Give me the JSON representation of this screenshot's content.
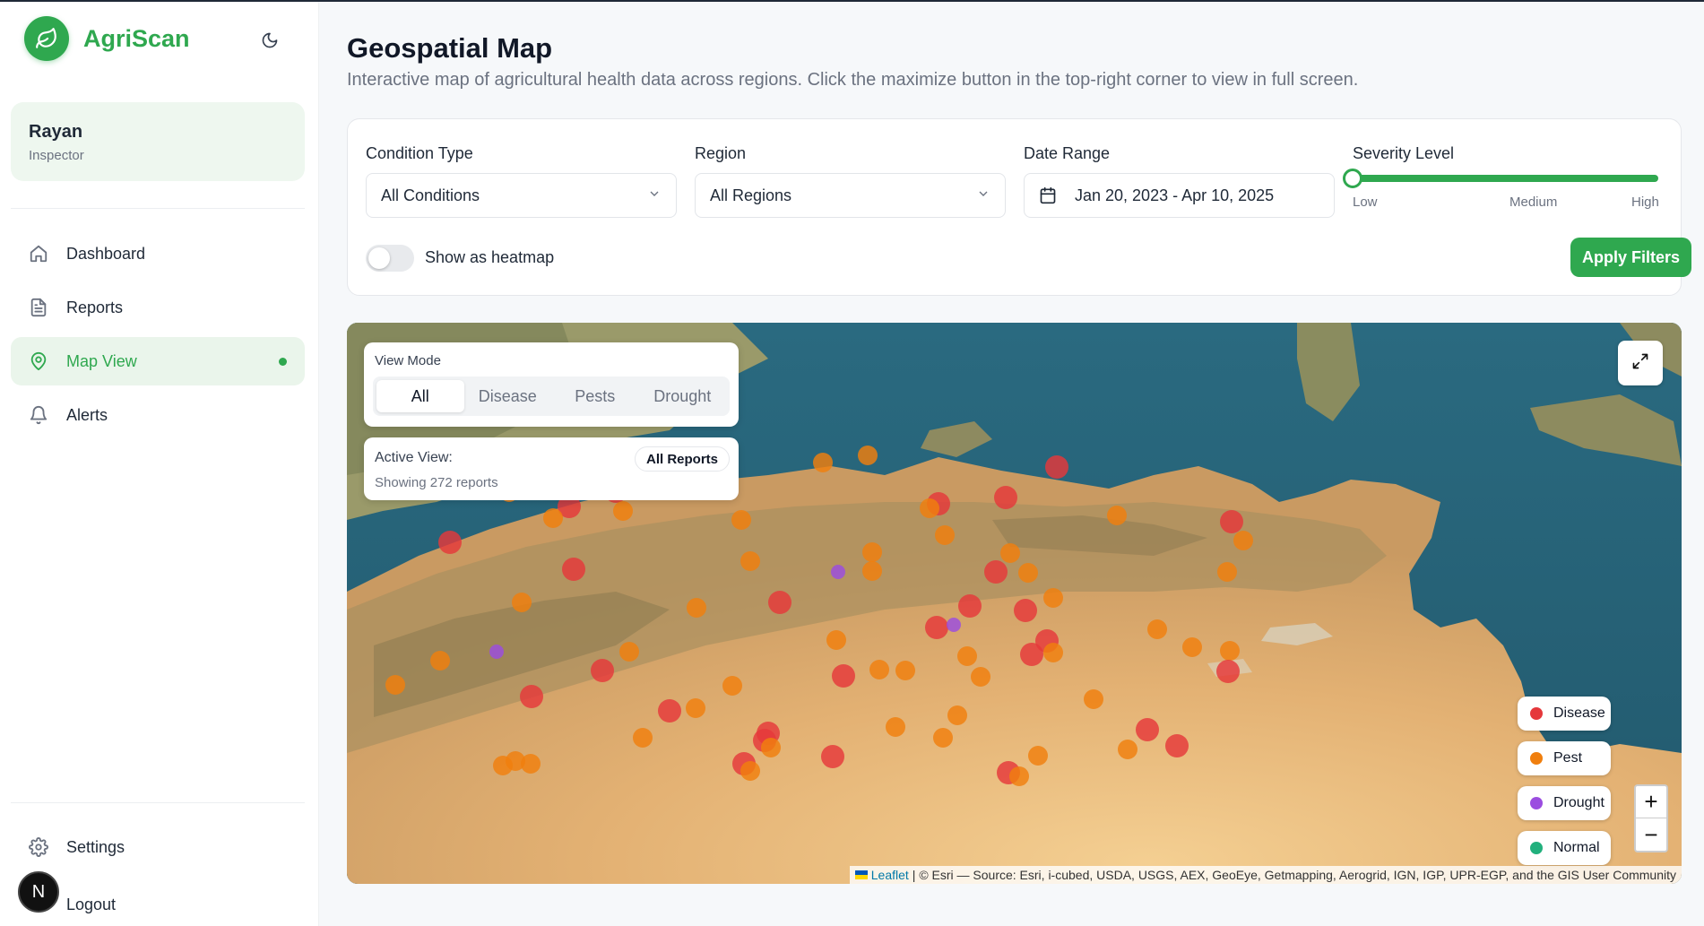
{
  "brand": {
    "name": "AgriScan"
  },
  "user": {
    "name": "Rayan",
    "role": "Inspector"
  },
  "nav": {
    "items": [
      {
        "label": "Dashboard"
      },
      {
        "label": "Reports"
      },
      {
        "label": "Map View"
      },
      {
        "label": "Alerts"
      }
    ],
    "settings": "Settings",
    "logout": "Logout",
    "avatar_letter": "N"
  },
  "page": {
    "title": "Geospatial Map",
    "subtitle": "Interactive map of agricultural health data across regions. Click the maximize button in the top-right corner to view in full screen."
  },
  "filters": {
    "condition_label": "Condition Type",
    "condition_value": "All Conditions",
    "region_label": "Region",
    "region_value": "All Regions",
    "date_label": "Date Range",
    "date_value": "Jan 20, 2023 - Apr 10, 2025",
    "severity_label": "Severity Level",
    "severity_low": "Low",
    "severity_medium": "Medium",
    "severity_high": "High",
    "severity_value": 0,
    "heatmap_label": "Show as heatmap",
    "heatmap_on": false,
    "apply_label": "Apply Filters"
  },
  "map": {
    "view_mode_title": "View Mode",
    "tabs": [
      "All",
      "Disease",
      "Pests",
      "Drought"
    ],
    "active_tab": "All",
    "active_view_label": "Active View:",
    "active_view_badge": "All Reports",
    "showing": "Showing 272 reports",
    "legend": [
      {
        "label": "Disease",
        "color": "#e5383b"
      },
      {
        "label": "Pest",
        "color": "#f07f0e"
      },
      {
        "label": "Drought",
        "color": "#9b4de0"
      },
      {
        "label": "Normal",
        "color": "#22b07d"
      }
    ],
    "zoom_in": "+",
    "zoom_out": "−",
    "attribution_link": "Leaflet",
    "attribution_text": "| © Esri — Source: Esri, i-cubed, USDA, USGS, AEX, GeoEye, Getmapping, Aerogrid, IGN, IGP, UPR-EGP, and the GIS User Community"
  },
  "colors": {
    "accent": "#2fa84f",
    "disease": "#e5383b",
    "pest": "#f07f0e",
    "drought": "#9b4de0",
    "normal": "#22b07d"
  }
}
